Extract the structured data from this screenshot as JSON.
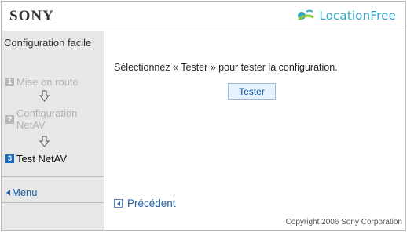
{
  "header": {
    "left_logo": "SONY",
    "brand": "LocationFree",
    "brand_icon": "locationfree-icon"
  },
  "sidebar": {
    "title": "Configuration facile",
    "steps": [
      {
        "number": "1",
        "label": "Mise en route",
        "state": "inactive"
      },
      {
        "number": "2",
        "label": "Configuration NetAV",
        "state": "inactive"
      },
      {
        "number": "3",
        "label": "Test NetAV",
        "state": "active"
      }
    ],
    "menu": "Menu"
  },
  "main": {
    "prompt": "Sélectionnez « Tester » pour tester la configuration.",
    "tester_button": "Tester",
    "previous_link": "Précédent",
    "copyright": "Copyright 2006 Sony Corporation"
  },
  "colors": {
    "accent": "#1a6bbd",
    "sidebar_bg": "#e8e8e8",
    "button_bg": "#e7f2ff"
  }
}
